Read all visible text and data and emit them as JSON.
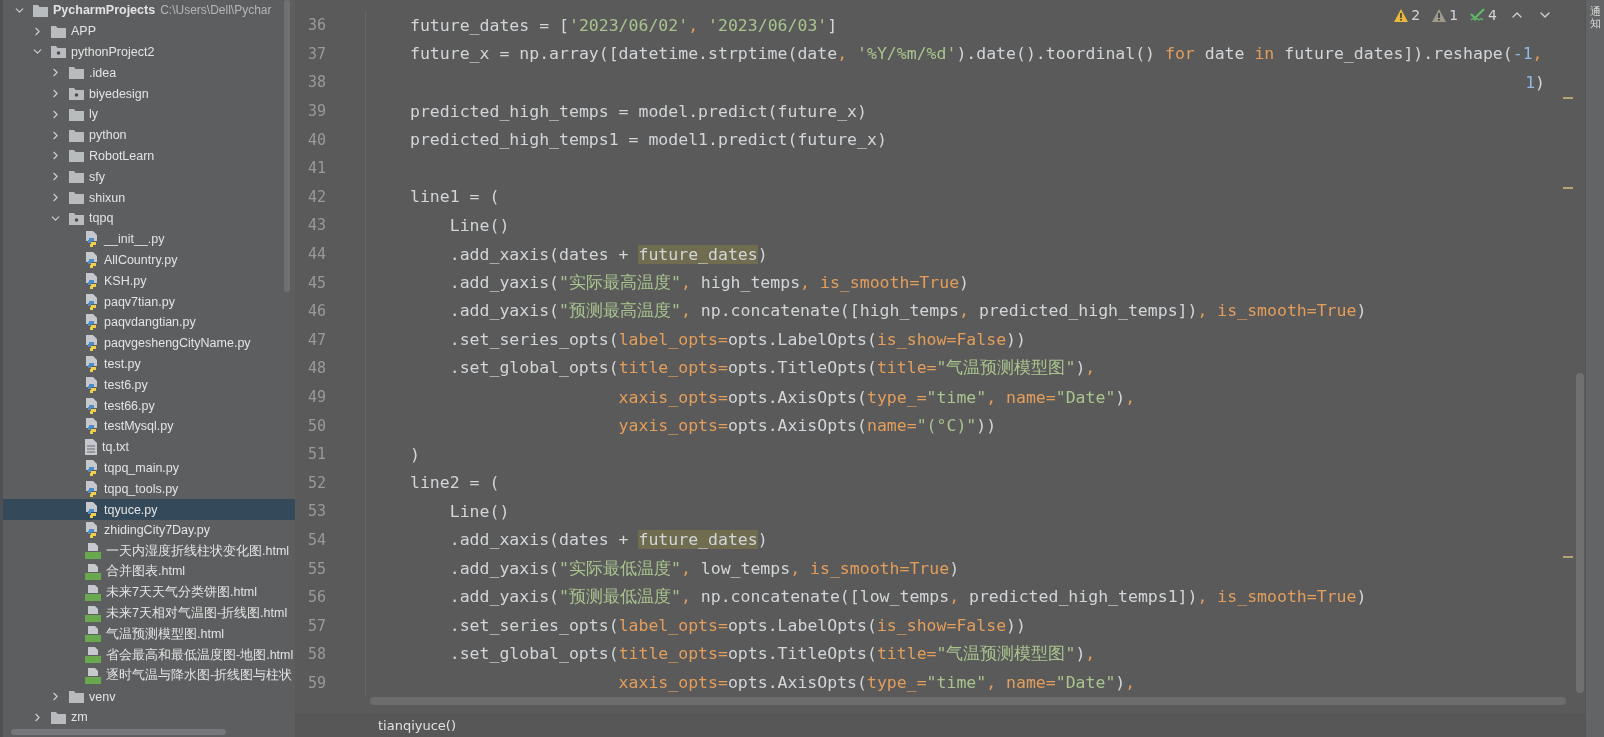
{
  "project_tree": {
    "name": "PycharmProjects",
    "path": "C:\\Users\\Dell\\Pychar",
    "kind": "folder",
    "expanded": true,
    "selected": false,
    "children": [
      {
        "name": "APP",
        "kind": "folder",
        "expanded": false,
        "selected": false
      },
      {
        "name": "pythonProject2",
        "kind": "module",
        "expanded": true,
        "selected": false,
        "children": [
          {
            "name": ".idea",
            "kind": "folder",
            "expanded": false,
            "selected": false
          },
          {
            "name": "biyedesign",
            "kind": "module",
            "expanded": false,
            "selected": false
          },
          {
            "name": "ly",
            "kind": "folder",
            "expanded": false,
            "selected": false
          },
          {
            "name": "python",
            "kind": "folder",
            "expanded": false,
            "selected": false
          },
          {
            "name": "RobotLearn",
            "kind": "folder",
            "expanded": false,
            "selected": false
          },
          {
            "name": "sfy",
            "kind": "folder",
            "expanded": false,
            "selected": false
          },
          {
            "name": "shixun",
            "kind": "folder",
            "expanded": false,
            "selected": false
          },
          {
            "name": "tqpq",
            "kind": "module",
            "expanded": true,
            "selected": false,
            "children": [
              {
                "name": "__init__.py",
                "kind": "py",
                "selected": false
              },
              {
                "name": "AllCountry.py",
                "kind": "py",
                "selected": false
              },
              {
                "name": "KSH.py",
                "kind": "py",
                "selected": false
              },
              {
                "name": "paqv7tian.py",
                "kind": "py",
                "selected": false
              },
              {
                "name": "paqvdangtian.py",
                "kind": "py",
                "selected": false
              },
              {
                "name": "paqvgeshengCityName.py",
                "kind": "py",
                "selected": false
              },
              {
                "name": "test.py",
                "kind": "py",
                "selected": false
              },
              {
                "name": "test6.py",
                "kind": "py",
                "selected": false
              },
              {
                "name": "test66.py",
                "kind": "py",
                "selected": false
              },
              {
                "name": "testMysql.py",
                "kind": "py",
                "selected": false
              },
              {
                "name": "tq.txt",
                "kind": "txt",
                "selected": false
              },
              {
                "name": "tqpq_main.py",
                "kind": "py",
                "selected": false
              },
              {
                "name": "tqpq_tools.py",
                "kind": "py",
                "selected": false
              },
              {
                "name": "tqyuce.py",
                "kind": "py",
                "selected": true
              },
              {
                "name": "zhidingCity7Day.py",
                "kind": "py",
                "selected": false
              },
              {
                "name": "一天内湿度折线柱状变化图.html",
                "kind": "html",
                "selected": false
              },
              {
                "name": "合并图表.html",
                "kind": "html",
                "selected": false
              },
              {
                "name": "未来7天天气分类饼图.html",
                "kind": "html",
                "selected": false
              },
              {
                "name": "未来7天相对气温图-折线图.html",
                "kind": "html",
                "selected": false
              },
              {
                "name": "气温预测模型图.html",
                "kind": "html",
                "selected": false
              },
              {
                "name": "省会最高和最低温度图-地图.html",
                "kind": "html",
                "selected": false
              },
              {
                "name": "逐时气温与降水图-折线图与柱状",
                "kind": "html",
                "selected": false
              }
            ]
          },
          {
            "name": "venv",
            "kind": "folder",
            "expanded": false,
            "selected": false
          }
        ]
      },
      {
        "name": "zm",
        "kind": "folder",
        "expanded": false,
        "selected": false
      }
    ]
  },
  "inspections": [
    {
      "kind": "warning",
      "count": "2"
    },
    {
      "kind": "weak",
      "count": "1"
    },
    {
      "kind": "typo",
      "count": "4"
    }
  ],
  "editor": {
    "lines": [
      {
        "number": "36",
        "kind": "top",
        "tokens": [
          {
            "text": "future_dates = [",
            "kind": "plain"
          },
          {
            "text": "'2023/06/02'",
            "kind": "string"
          },
          {
            "text": ", ",
            "kind": "keyword"
          },
          {
            "text": "'2023/06/03'",
            "kind": "string"
          },
          {
            "text": "]",
            "kind": "plain"
          }
        ]
      },
      {
        "number": "37",
        "kind": "top",
        "tokens": [
          {
            "text": "future_x = np.array([datetime.strptime(date",
            "kind": "plain"
          },
          {
            "text": ", ",
            "kind": "keyword"
          },
          {
            "text": "'%Y/%m/%d'",
            "kind": "string"
          },
          {
            "text": ").date().toordinal() ",
            "kind": "plain"
          },
          {
            "text": "for",
            "kind": "keyword"
          },
          {
            "text": " date ",
            "kind": "plain"
          },
          {
            "text": "in",
            "kind": "keyword"
          },
          {
            "text": " future_dates]).reshape(",
            "kind": "plain"
          },
          {
            "text": "-1",
            "kind": "number"
          },
          {
            "text": ",",
            "kind": "keyword"
          }
        ]
      },
      {
        "number": "38",
        "kind": "wrap",
        "tokens": [
          {
            "text": "1",
            "kind": "number"
          },
          {
            "text": ")",
            "kind": "plain"
          }
        ]
      },
      {
        "number": "39",
        "kind": "top",
        "tokens": [
          {
            "text": "predicted_high_temps = model.predict(future_x)",
            "kind": "plain"
          }
        ]
      },
      {
        "number": "40",
        "kind": "top",
        "tokens": [
          {
            "text": "predicted_high_temps1 = model1.predict(future_x)",
            "kind": "plain"
          }
        ]
      },
      {
        "number": "41",
        "kind": "top"
      },
      {
        "number": "42",
        "kind": "top",
        "tokens": [
          {
            "text": "line1 = (",
            "kind": "plain"
          }
        ]
      },
      {
        "number": "43",
        "kind": "body",
        "tokens": [
          {
            "text": "Line()",
            "kind": "plain"
          }
        ]
      },
      {
        "number": "44",
        "kind": "body",
        "tokens": [
          {
            "text": ".add_xaxis(dates + ",
            "kind": "plain"
          },
          {
            "text": "future_dates",
            "kind": "usage"
          },
          {
            "text": ")",
            "kind": "plain"
          }
        ]
      },
      {
        "number": "45",
        "kind": "body",
        "tokens": [
          {
            "text": ".add_yaxis(",
            "kind": "plain"
          },
          {
            "text": "\"实际最高温度\"",
            "kind": "string"
          },
          {
            "text": ", ",
            "kind": "keyword"
          },
          {
            "text": "high_temps",
            "kind": "plain"
          },
          {
            "text": ", ",
            "kind": "keyword"
          },
          {
            "text": "is_smooth=",
            "kind": "param"
          },
          {
            "text": "True",
            "kind": "keyword"
          },
          {
            "text": ")",
            "kind": "plain"
          }
        ]
      },
      {
        "number": "46",
        "kind": "body",
        "tokens": [
          {
            "text": ".add_yaxis(",
            "kind": "plain"
          },
          {
            "text": "\"预测最高温度\"",
            "kind": "string"
          },
          {
            "text": ", ",
            "kind": "keyword"
          },
          {
            "text": "np.concatenate([high_temps",
            "kind": "plain"
          },
          {
            "text": ", ",
            "kind": "keyword"
          },
          {
            "text": "predicted_high_temps])",
            "kind": "plain"
          },
          {
            "text": ", ",
            "kind": "keyword"
          },
          {
            "text": "is_smooth=",
            "kind": "param"
          },
          {
            "text": "True",
            "kind": "keyword"
          },
          {
            "text": ")",
            "kind": "plain"
          }
        ]
      },
      {
        "number": "47",
        "kind": "body",
        "tokens": [
          {
            "text": ".set_series_opts(",
            "kind": "plain"
          },
          {
            "text": "label_opts=",
            "kind": "param"
          },
          {
            "text": "opts.LabelOpts(",
            "kind": "plain"
          },
          {
            "text": "is_show=",
            "kind": "param"
          },
          {
            "text": "False",
            "kind": "keyword"
          },
          {
            "text": "))",
            "kind": "plain"
          }
        ]
      },
      {
        "number": "48",
        "kind": "body",
        "tokens": [
          {
            "text": ".set_global_opts(",
            "kind": "plain"
          },
          {
            "text": "title_opts=",
            "kind": "param"
          },
          {
            "text": "opts.TitleOpts(",
            "kind": "plain"
          },
          {
            "text": "title=",
            "kind": "param"
          },
          {
            "text": "\"气温预测模型图\"",
            "kind": "string"
          },
          {
            "text": ")",
            "kind": "plain"
          },
          {
            "text": ",",
            "kind": "keyword"
          }
        ]
      },
      {
        "number": "49",
        "kind": "args",
        "tokens": [
          {
            "text": "xaxis_opts=",
            "kind": "param"
          },
          {
            "text": "opts.AxisOpts(",
            "kind": "plain"
          },
          {
            "text": "type_=",
            "kind": "param"
          },
          {
            "text": "\"time\"",
            "kind": "string"
          },
          {
            "text": ", ",
            "kind": "keyword"
          },
          {
            "text": "name=",
            "kind": "param"
          },
          {
            "text": "\"Date\"",
            "kind": "string"
          },
          {
            "text": ")",
            "kind": "plain"
          },
          {
            "text": ",",
            "kind": "keyword"
          }
        ]
      },
      {
        "number": "50",
        "kind": "args",
        "tokens": [
          {
            "text": "yaxis_opts=",
            "kind": "param"
          },
          {
            "text": "opts.AxisOpts(",
            "kind": "plain"
          },
          {
            "text": "name=",
            "kind": "param"
          },
          {
            "text": "\"(°C)\"",
            "kind": "string"
          },
          {
            "text": "))",
            "kind": "plain"
          }
        ]
      },
      {
        "number": "51",
        "kind": "top",
        "tokens": [
          {
            "text": ")",
            "kind": "plain"
          }
        ]
      },
      {
        "number": "52",
        "kind": "top",
        "tokens": [
          {
            "text": "line2 = (",
            "kind": "plain"
          }
        ]
      },
      {
        "number": "53",
        "kind": "body",
        "tokens": [
          {
            "text": "Line()",
            "kind": "plain"
          }
        ]
      },
      {
        "number": "54",
        "kind": "body",
        "tokens": [
          {
            "text": ".add_xaxis(dates + ",
            "kind": "plain"
          },
          {
            "text": "future_dates",
            "kind": "usage"
          },
          {
            "text": ")",
            "kind": "plain"
          }
        ]
      },
      {
        "number": "55",
        "kind": "body",
        "tokens": [
          {
            "text": ".add_yaxis(",
            "kind": "plain"
          },
          {
            "text": "\"实际最低温度\"",
            "kind": "string"
          },
          {
            "text": ", ",
            "kind": "keyword"
          },
          {
            "text": "low_temps",
            "kind": "plain"
          },
          {
            "text": ", ",
            "kind": "keyword"
          },
          {
            "text": "is_smooth=",
            "kind": "param"
          },
          {
            "text": "True",
            "kind": "keyword"
          },
          {
            "text": ")",
            "kind": "plain"
          }
        ]
      },
      {
        "number": "56",
        "kind": "body",
        "tokens": [
          {
            "text": ".add_yaxis(",
            "kind": "plain"
          },
          {
            "text": "\"预测最低温度\"",
            "kind": "string"
          },
          {
            "text": ", ",
            "kind": "keyword"
          },
          {
            "text": "np.concatenate([low_temps",
            "kind": "plain"
          },
          {
            "text": ", ",
            "kind": "keyword"
          },
          {
            "text": "predicted_high_temps1])",
            "kind": "plain"
          },
          {
            "text": ", ",
            "kind": "keyword"
          },
          {
            "text": "is_smooth=",
            "kind": "param"
          },
          {
            "text": "True",
            "kind": "keyword"
          },
          {
            "text": ")",
            "kind": "plain"
          }
        ]
      },
      {
        "number": "57",
        "kind": "body",
        "tokens": [
          {
            "text": ".set_series_opts(",
            "kind": "plain"
          },
          {
            "text": "label_opts=",
            "kind": "param"
          },
          {
            "text": "opts.LabelOpts(",
            "kind": "plain"
          },
          {
            "text": "is_show=",
            "kind": "param"
          },
          {
            "text": "False",
            "kind": "keyword"
          },
          {
            "text": "))",
            "kind": "plain"
          }
        ]
      },
      {
        "number": "58",
        "kind": "body",
        "tokens": [
          {
            "text": ".set_global_opts(",
            "kind": "plain"
          },
          {
            "text": "title_opts=",
            "kind": "param"
          },
          {
            "text": "opts.TitleOpts(",
            "kind": "plain"
          },
          {
            "text": "title=",
            "kind": "param"
          },
          {
            "text": "\"气温预测模型图\"",
            "kind": "string"
          },
          {
            "text": ")",
            "kind": "plain"
          },
          {
            "text": ",",
            "kind": "keyword"
          }
        ]
      },
      {
        "number": "59",
        "kind": "args",
        "tokens": [
          {
            "text": "xaxis_opts=",
            "kind": "param"
          },
          {
            "text": "opts.AxisOpts(",
            "kind": "plain"
          },
          {
            "text": "type_=",
            "kind": "param"
          },
          {
            "text": "\"time\"",
            "kind": "string"
          },
          {
            "text": ", ",
            "kind": "keyword"
          },
          {
            "text": "name=",
            "kind": "param"
          },
          {
            "text": "\"Date\"",
            "kind": "string"
          },
          {
            "text": ")",
            "kind": "plain"
          },
          {
            "text": ",",
            "kind": "keyword"
          }
        ]
      }
    ]
  },
  "breadcrumb": "tianqiyuce()",
  "side_strip": "通知"
}
